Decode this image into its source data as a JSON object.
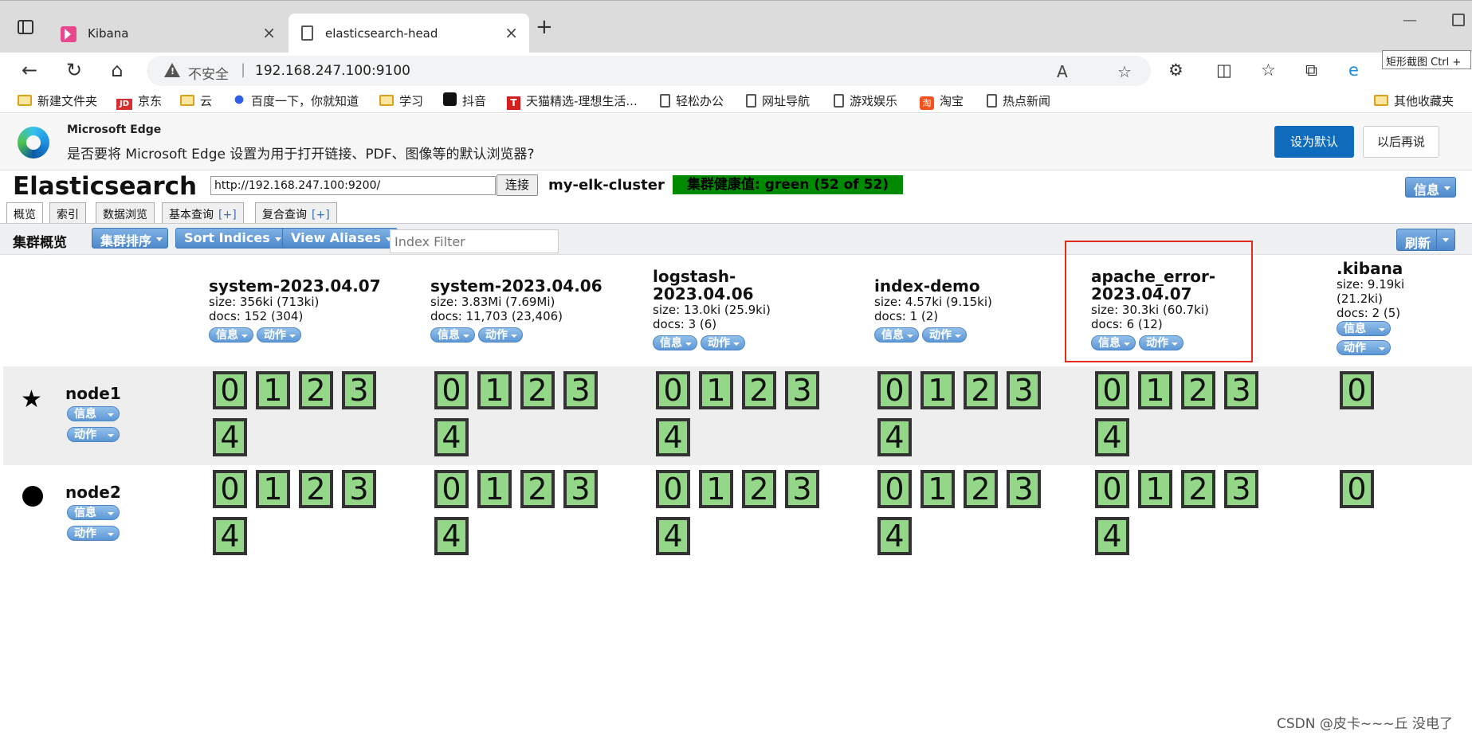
{
  "browser": {
    "tabs": [
      {
        "title": "Kibana"
      },
      {
        "title": "elasticsearch-head"
      }
    ],
    "address": {
      "insecure_label": "不安全",
      "separator": "|",
      "url": "192.168.247.100:9100"
    },
    "tooltip": "矩形截图 Ctrl + ",
    "bookmarks": [
      {
        "label": "新建文件夹",
        "icon": "folder-icon"
      },
      {
        "label": "京东",
        "icon": "jd-icon",
        "mark": "JD"
      },
      {
        "label": "云",
        "icon": "folder-icon"
      },
      {
        "label": "百度一下，你就知道",
        "icon": "baidu-icon"
      },
      {
        "label": "学习",
        "icon": "folder-icon"
      },
      {
        "label": "抖音",
        "icon": "tiktok-icon"
      },
      {
        "label": "天猫精选-理想生活...",
        "icon": "tmall-icon",
        "mark": "T"
      },
      {
        "label": "轻松办公",
        "icon": "page-icon"
      },
      {
        "label": "网址导航",
        "icon": "page-icon"
      },
      {
        "label": "游戏娱乐",
        "icon": "page-icon"
      },
      {
        "label": "淘宝",
        "icon": "taobao-icon",
        "mark": "淘"
      },
      {
        "label": "热点新闻",
        "icon": "page-icon"
      }
    ],
    "other_bookmarks": "其他收藏夹"
  },
  "infobar": {
    "title": "Microsoft Edge",
    "message": "是否要将 Microsoft Edge 设置为用于打开链接、PDF、图像等的默认浏览器?",
    "primary_button": "设为默认",
    "secondary_button": "以后再说"
  },
  "es_head": {
    "title": "Elasticsearch",
    "connect_url": "http://192.168.247.100:9200/",
    "connect_button": "连接",
    "cluster_name": "my-elk-cluster",
    "health": "集群健康值: green (52 of 52)",
    "info_button": "信息",
    "tabs": [
      {
        "label": "概览",
        "plus": ""
      },
      {
        "label": "索引",
        "plus": ""
      },
      {
        "label": "数据浏览",
        "plus": ""
      },
      {
        "label": "基本查询",
        "plus": "[+]"
      },
      {
        "label": "复合查询",
        "plus": "[+]"
      }
    ],
    "toolbar": {
      "label": "集群概览",
      "sort_cluster": "集群排序",
      "sort_indices": "Sort Indices",
      "view_aliases": "View Aliases",
      "filter_placeholder": "Index Filter",
      "refresh": "刷新"
    },
    "pill_info": "信息",
    "pill_action": "动作",
    "indices": [
      {
        "name_lines": [
          "system-2023.04.07"
        ],
        "size": "size: 356ki (713ki)",
        "docs": "docs: 152 (304)",
        "shards": [
          "0",
          "1",
          "2",
          "3",
          "4"
        ]
      },
      {
        "name_lines": [
          "system-2023.04.06"
        ],
        "size": "size: 3.83Mi (7.69Mi)",
        "docs": "docs: 11,703 (23,406)",
        "shards": [
          "0",
          "1",
          "2",
          "3",
          "4"
        ]
      },
      {
        "name_lines": [
          "logstash-",
          "2023.04.06"
        ],
        "size": "size: 13.0ki (25.9ki)",
        "docs": "docs: 3 (6)",
        "shards": [
          "0",
          "1",
          "2",
          "3",
          "4"
        ]
      },
      {
        "name_lines": [
          "index-demo"
        ],
        "size": "size: 4.57ki (9.15ki)",
        "docs": "docs: 1 (2)",
        "shards": [
          "0",
          "1",
          "2",
          "3",
          "4"
        ]
      },
      {
        "name_lines": [
          "apache_error-",
          "2023.04.07"
        ],
        "size": "size: 30.3ki (60.7ki)",
        "docs": "docs: 6 (12)",
        "shards": [
          "0",
          "1",
          "2",
          "3",
          "4"
        ]
      },
      {
        "name_lines": [
          ".kibana"
        ],
        "size_lines": [
          "size: 9.19ki",
          "(21.2ki)"
        ],
        "docs": "docs: 2 (5)",
        "shards": [
          "0"
        ]
      }
    ],
    "nodes": [
      {
        "name": "node1",
        "marker": "star-icon",
        "marker_glyph": "★"
      },
      {
        "name": "node2",
        "marker": "circle-icon"
      }
    ]
  },
  "watermark": "CSDN @皮卡~~~丘 没电了"
}
